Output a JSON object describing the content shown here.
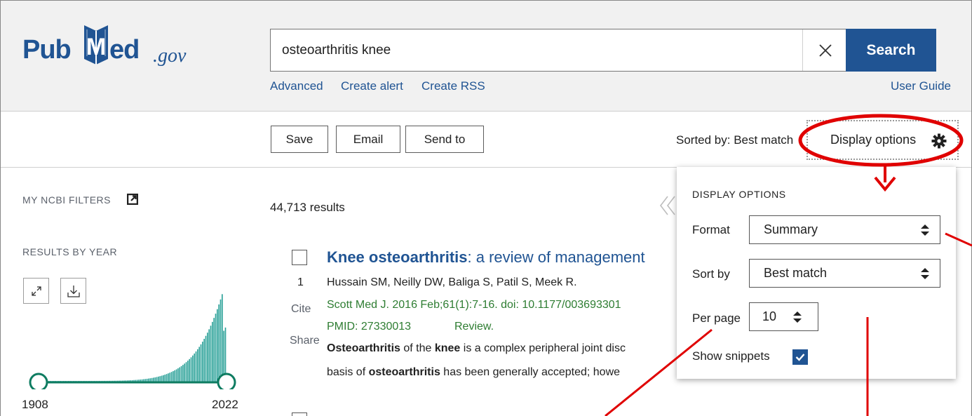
{
  "header": {
    "logo": {
      "part1": "Pub",
      "part2": "ed",
      "suffix": ".gov",
      "brand_color": "#205493"
    },
    "search": {
      "value": "osteoarthritis knee",
      "button_label": "Search"
    },
    "links": {
      "advanced": "Advanced",
      "create_alert": "Create alert",
      "create_rss": "Create RSS",
      "user_guide": "User Guide"
    }
  },
  "toolbar": {
    "save_label": "Save",
    "email_label": "Email",
    "send_to_label": "Send to",
    "sorted_by": "Sorted by: Best match",
    "display_options_label": "Display options"
  },
  "sidebar": {
    "my_ncbi_filters": "MY NCBI FILTERS",
    "results_by_year": "RESULTS BY YEAR",
    "year_start": "1908",
    "year_end": "2022"
  },
  "results": {
    "count": "44,713 results",
    "items": [
      {
        "number": "1",
        "title_bold": "Knee osteoarthritis",
        "title_rest": ": a review of management",
        "authors": "Hussain SM, Neilly DW, Baliga S, Patil S, Meek R.",
        "citation": "Scott Med J. 2016 Feb;61(1):7-16. doi: 10.1177/003693301",
        "pmid": "PMID: 27330013",
        "type": "Review.",
        "snippet1": [
          {
            "t": "Osteoarthritis",
            "b": true
          },
          {
            "t": " of the ",
            "b": false
          },
          {
            "t": "knee",
            "b": true
          },
          {
            "t": " is a complex peripheral joint disc",
            "b": false
          }
        ],
        "snippet2": [
          {
            "t": "basis of ",
            "b": false
          },
          {
            "t": "osteoarthritis",
            "b": true
          },
          {
            "t": " has been generally accepted; howe",
            "b": false
          }
        ],
        "cite_label": "Cite",
        "share_label": "Share"
      }
    ]
  },
  "display_panel": {
    "title": "DISPLAY OPTIONS",
    "format_label": "Format",
    "format_value": "Summary",
    "sort_label": "Sort by",
    "sort_value": "Best match",
    "per_page_label": "Per page",
    "per_page_value": "10",
    "snippets_label": "Show snippets",
    "snippets_checked": true
  },
  "histogram": {
    "bar_color": "#2aa198",
    "slider_color": "#0e7c61"
  },
  "annotation_color": "#e00000"
}
